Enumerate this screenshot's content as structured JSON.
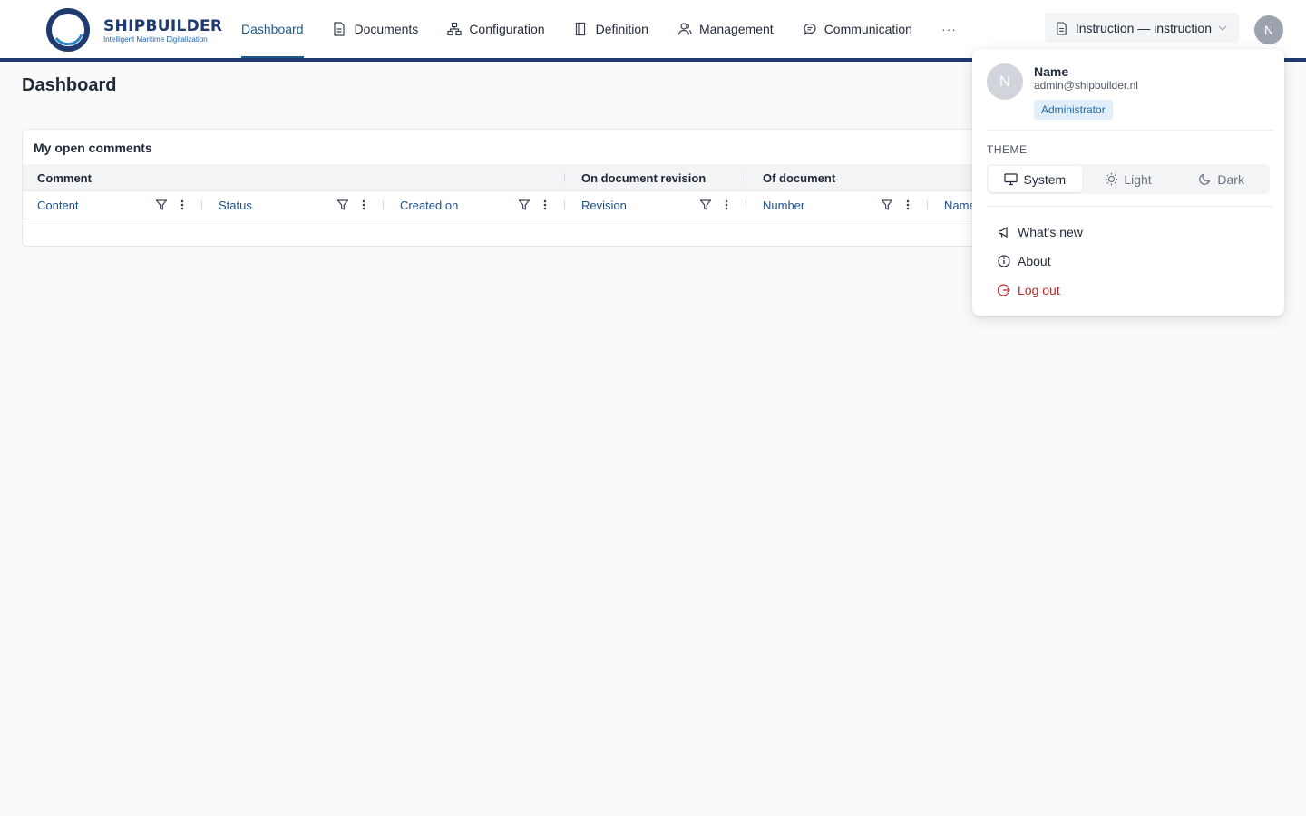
{
  "brand": {
    "name": "SHIPBUILDER",
    "tagline": "Intelligent Maritime Digitalization",
    "colors": {
      "primary": "#1e3a6e",
      "accent": "#1e5a8a",
      "danger": "#c02a2a"
    }
  },
  "nav": {
    "items": [
      {
        "label": "Dashboard",
        "icon": "",
        "active": true
      },
      {
        "label": "Documents",
        "icon": "document-icon"
      },
      {
        "label": "Configuration",
        "icon": "hierarchy-icon"
      },
      {
        "label": "Definition",
        "icon": "book-icon"
      },
      {
        "label": "Management",
        "icon": "users-icon"
      },
      {
        "label": "Communication",
        "icon": "chat-icon"
      }
    ],
    "more_label": "···"
  },
  "context_select": {
    "value": "Instruction — instruction",
    "icon": "document-icon"
  },
  "user": {
    "initial": "N",
    "name": "Name",
    "email": "admin@shipbuilder.nl",
    "role": "Administrator"
  },
  "page": {
    "title": "Dashboard"
  },
  "comments_card": {
    "title": "My open comments",
    "groups": [
      "Comment",
      "On document revision",
      "Of document"
    ],
    "columns": [
      "Content",
      "Status",
      "Created on",
      "Revision",
      "Number",
      "Name"
    ]
  },
  "user_menu": {
    "theme_label": "THEME",
    "theme_options": [
      {
        "label": "System",
        "icon": "monitor-icon",
        "selected": true
      },
      {
        "label": "Light",
        "icon": "sun-icon"
      },
      {
        "label": "Dark",
        "icon": "moon-icon"
      }
    ],
    "items": [
      {
        "label": "What's new",
        "icon": "megaphone-icon"
      },
      {
        "label": "About",
        "icon": "info-icon"
      },
      {
        "label": "Log out",
        "icon": "logout-icon",
        "danger": true
      }
    ]
  }
}
